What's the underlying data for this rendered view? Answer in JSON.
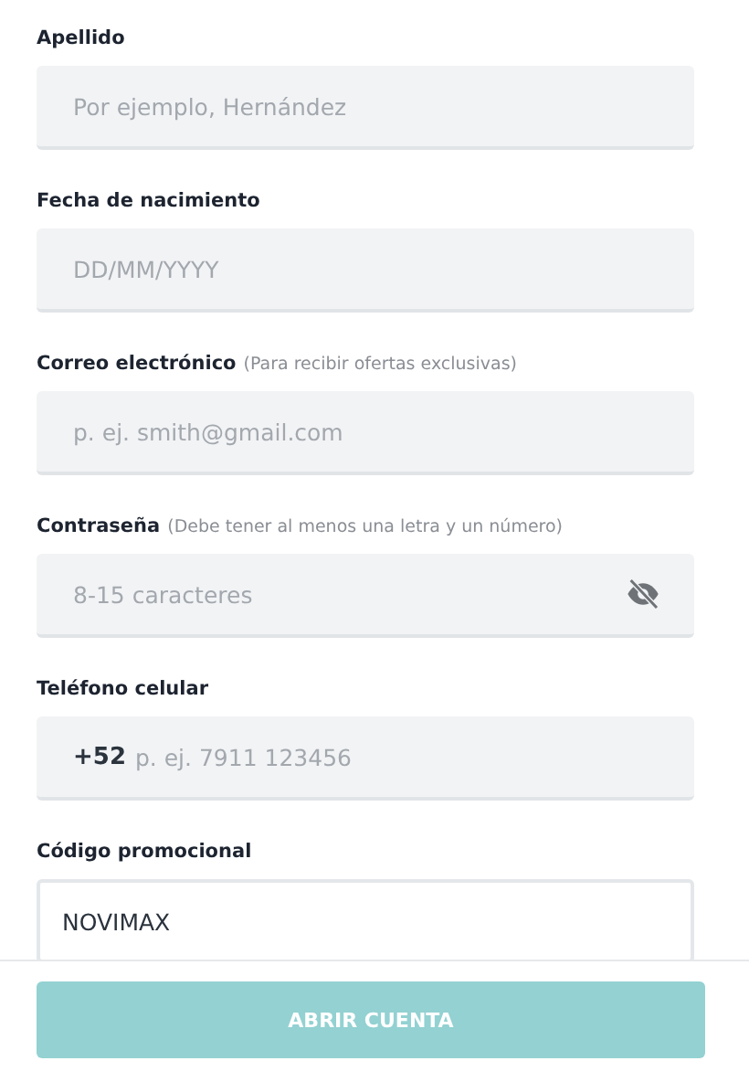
{
  "fields": [
    {
      "kind": "text",
      "label": "Apellido",
      "placeholder": "Por ejemplo, Hernández",
      "focused": false
    },
    {
      "kind": "text",
      "label": "Fecha de nacimiento",
      "placeholder": "DD/MM/YYYY",
      "focused": false
    },
    {
      "kind": "text",
      "label": "Correo electrónico",
      "hint": "(Para recibir ofertas exclusivas)",
      "placeholder": "p. ej. smith@gmail.com",
      "focused": false
    },
    {
      "kind": "password",
      "label": "Contraseña",
      "hint": "(Debe tener al menos una letra y un número)",
      "placeholder": "8-15 caracteres",
      "focused": false
    },
    {
      "kind": "phone",
      "label": "Teléfono celular",
      "prefix": "+52",
      "placeholder": "p. ej. 7911 123456",
      "focused": false
    },
    {
      "kind": "text",
      "label": "Código promocional",
      "value": "NOVIMAX",
      "focused": true
    }
  ],
  "submit": {
    "label": "ABRIR CUENTA",
    "disabled": true
  }
}
